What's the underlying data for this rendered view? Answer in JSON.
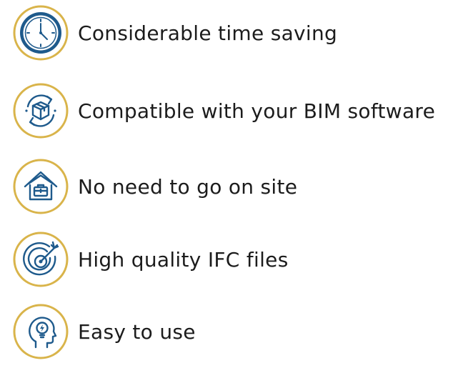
{
  "colors": {
    "ring": "#D9B44A",
    "icon": "#1E5A8C",
    "text": "#1C1C1C"
  },
  "features": [
    {
      "label": "Considerable time saving",
      "icon": "clock-icon"
    },
    {
      "label": "Compatible with your BIM software",
      "icon": "sync-cube-icon"
    },
    {
      "label": "No need to go on site",
      "icon": "house-briefcase-icon"
    },
    {
      "label": "High quality IFC files",
      "icon": "target-arrow-icon"
    },
    {
      "label": "Easy to use",
      "icon": "head-lightbulb-icon"
    }
  ]
}
